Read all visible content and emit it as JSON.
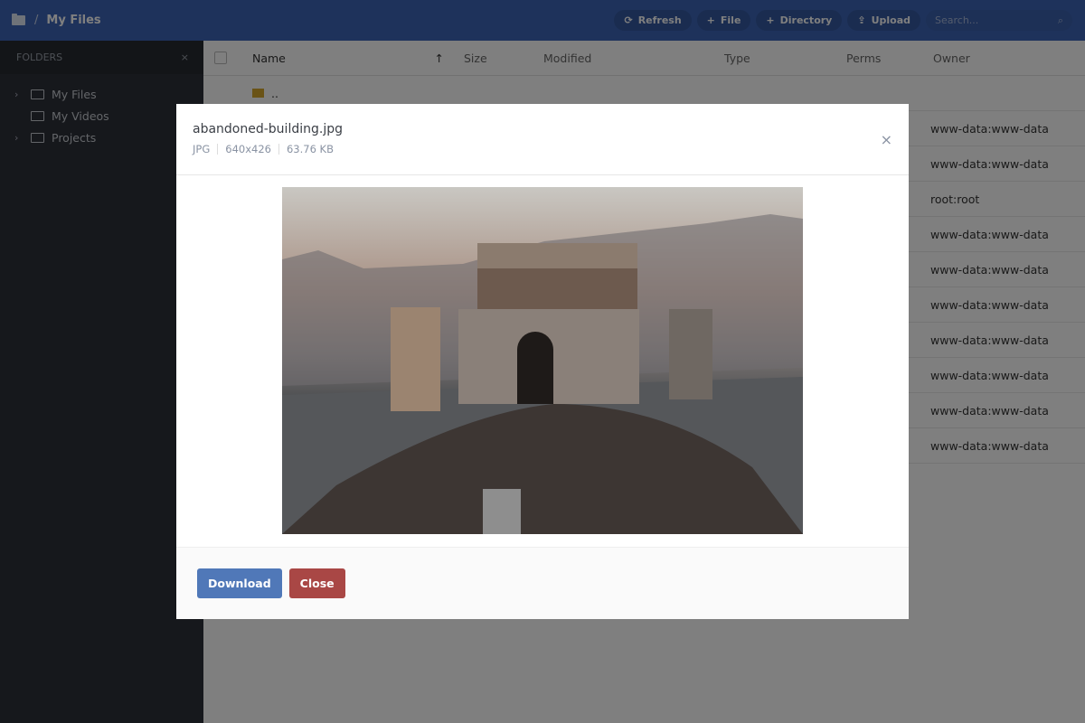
{
  "topbar": {
    "root_icon": "folder-icon",
    "separator": "/",
    "current": "My Files",
    "actions": [
      {
        "icon": "refresh-icon",
        "glyph": "⟳",
        "label": "Refresh"
      },
      {
        "icon": "plus-icon",
        "glyph": "+",
        "label": "File"
      },
      {
        "icon": "plus-icon",
        "glyph": "+",
        "label": "Directory"
      },
      {
        "icon": "upload-icon",
        "glyph": "⇪",
        "label": "Upload"
      }
    ],
    "search_placeholder": "Search..."
  },
  "sidebar": {
    "title": "FOLDERS",
    "close": "×",
    "items": [
      {
        "label": "My Files",
        "expandable": true
      },
      {
        "label": "My Videos",
        "expandable": false
      },
      {
        "label": "Projects",
        "expandable": true
      }
    ]
  },
  "table": {
    "columns": [
      "Name",
      "Size",
      "Modified",
      "Type",
      "Perms",
      "Owner"
    ],
    "sort_indicator": "↑",
    "parent_row": "..",
    "owners": [
      "www-data:www-data",
      "www-data:www-data",
      "root:root",
      "www-data:www-data",
      "www-data:www-data",
      "www-data:www-data",
      "www-data:www-data",
      "www-data:www-data",
      "www-data:www-data",
      "www-data:www-data"
    ]
  },
  "modal": {
    "title": "abandoned-building.jpg",
    "type": "JPG",
    "dimensions": "640x426",
    "size": "63.76 KB",
    "close": "×",
    "buttons": {
      "download": "Download",
      "close": "Close"
    },
    "colors": {
      "download": "#5078b8",
      "close": "#a94745"
    }
  }
}
